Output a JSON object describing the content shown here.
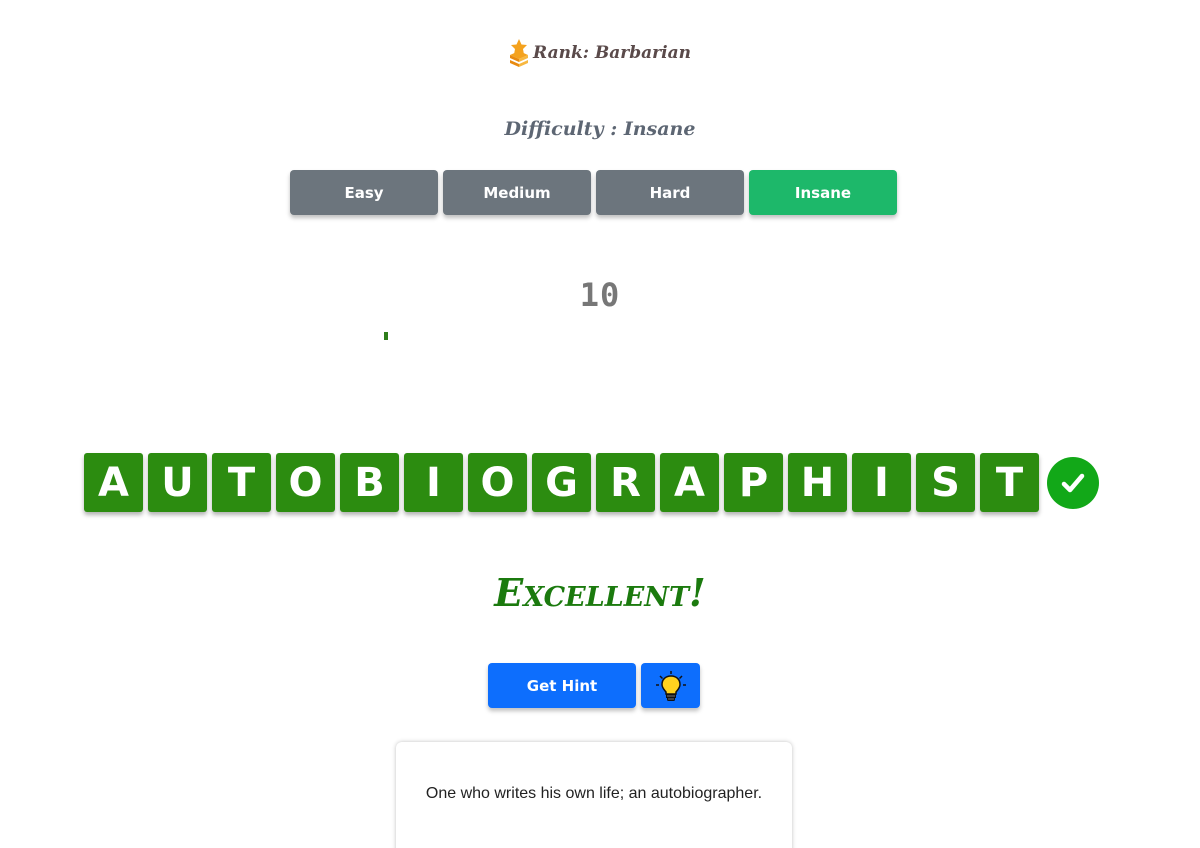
{
  "rank": {
    "label": "Rank: Barbarian",
    "icon": "rank-medal-icon"
  },
  "difficulty": {
    "title": "Difficulty : Insane",
    "options": [
      "Easy",
      "Medium",
      "Hard",
      "Insane"
    ],
    "selected": "Insane"
  },
  "timer": {
    "value": "10"
  },
  "word": {
    "letters": [
      "A",
      "U",
      "T",
      "O",
      "B",
      "I",
      "O",
      "G",
      "R",
      "A",
      "P",
      "H",
      "I",
      "S",
      "T"
    ],
    "status_icon": "check-circle-icon"
  },
  "feedback": {
    "text": "Excellent!"
  },
  "hint": {
    "button_label": "Get Hint",
    "bulb_icon": "lightbulb-icon"
  },
  "definition": {
    "text": "One who writes his own life; an autobiographer."
  },
  "colors": {
    "tile": "#2c8c10",
    "active_difficulty": "#1db86a",
    "inactive_difficulty": "#6c757d",
    "hint_button": "#0d6efd",
    "feedback": "#1b7a0e",
    "check": "#12a818"
  }
}
